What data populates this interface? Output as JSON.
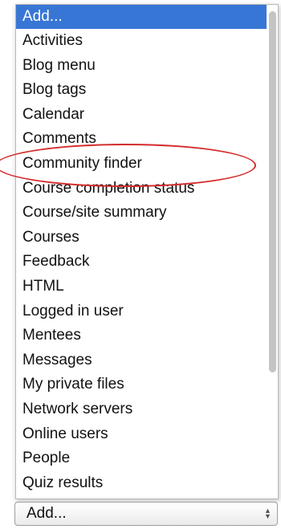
{
  "dropdown": {
    "options": [
      "Add...",
      "Activities",
      "Blog menu",
      "Blog tags",
      "Calendar",
      "Comments",
      "Community finder",
      "Course completion status",
      "Course/site summary",
      "Courses",
      "Feedback",
      "HTML",
      "Logged in user",
      "Mentees",
      "Messages",
      "My private files",
      "Network servers",
      "Online users",
      "People",
      "Quiz results"
    ],
    "selected_index": 0,
    "highlighted_option": "Community finder"
  },
  "select": {
    "value": "Add..."
  },
  "colors": {
    "selection": "#3876d6",
    "annotation": "#d42b2b"
  }
}
